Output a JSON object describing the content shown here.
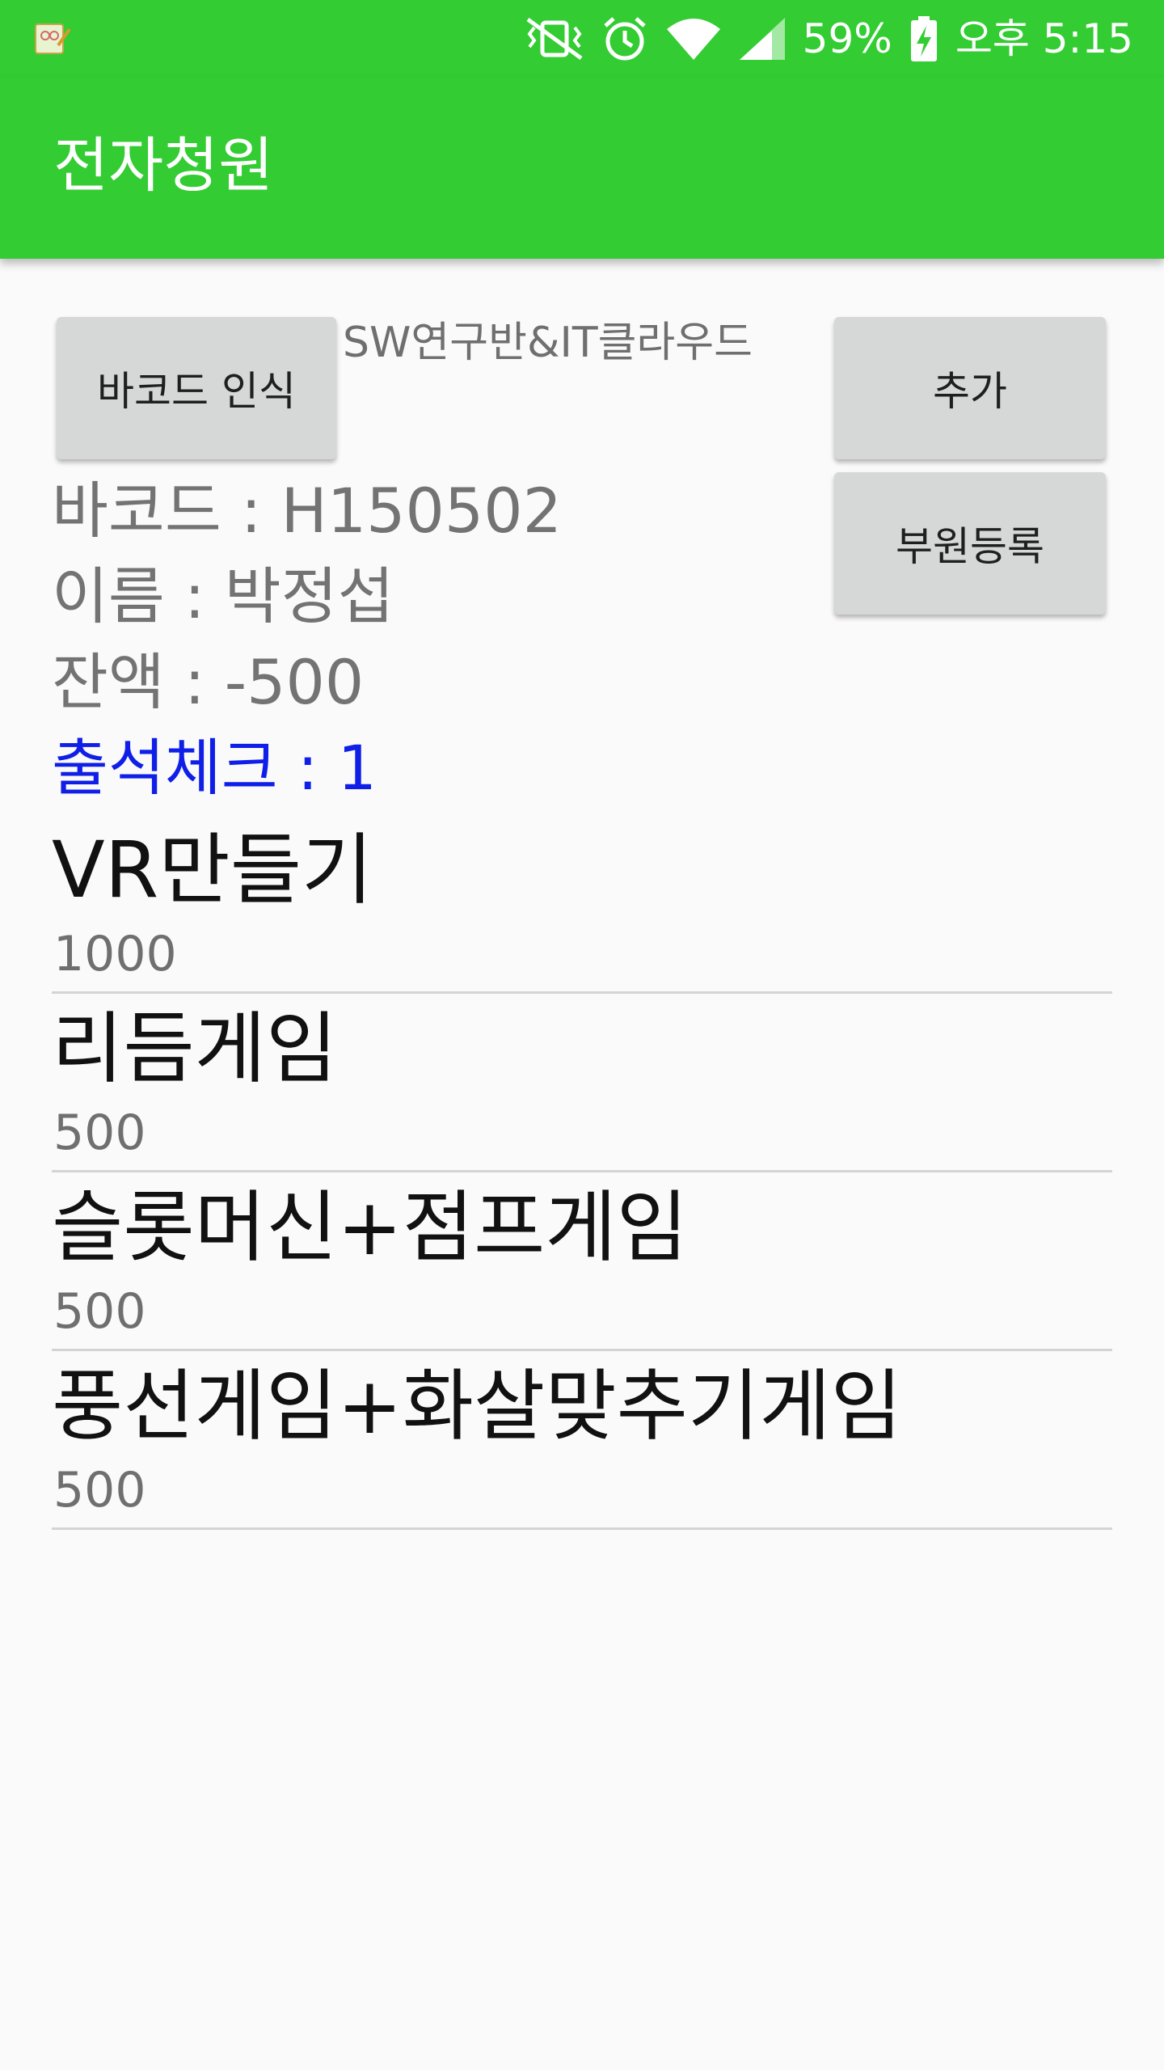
{
  "status_bar": {
    "battery": "59%",
    "time": "오후 5:15",
    "icons": [
      "app-notification-icon",
      "vibrate-icon",
      "alarm-icon",
      "wifi-icon",
      "signal-icon",
      "battery-charging-icon"
    ]
  },
  "app_bar": {
    "title": "전자청원"
  },
  "buttons": {
    "barcode_scan": "바코드 인식",
    "add": "추가",
    "member_register": "부원등록"
  },
  "club_label": "SW연구반&IT클라우드",
  "info": {
    "barcode": "바코드 : H150502",
    "name": "이름 : 박정섭",
    "balance": "잔액 : -500",
    "attendance": "출석체크 : 1"
  },
  "items": [
    {
      "title": "VR만들기",
      "price": "1000"
    },
    {
      "title": "리듬게임",
      "price": "500"
    },
    {
      "title": "슬롯머신+점프게임",
      "price": "500"
    },
    {
      "title": "풍선게임+화살맞추기게임",
      "price": "500"
    }
  ],
  "colors": {
    "primary": "#33cc33",
    "attendance_text": "#0f1fe8",
    "button_bg": "#d6d7d7"
  }
}
